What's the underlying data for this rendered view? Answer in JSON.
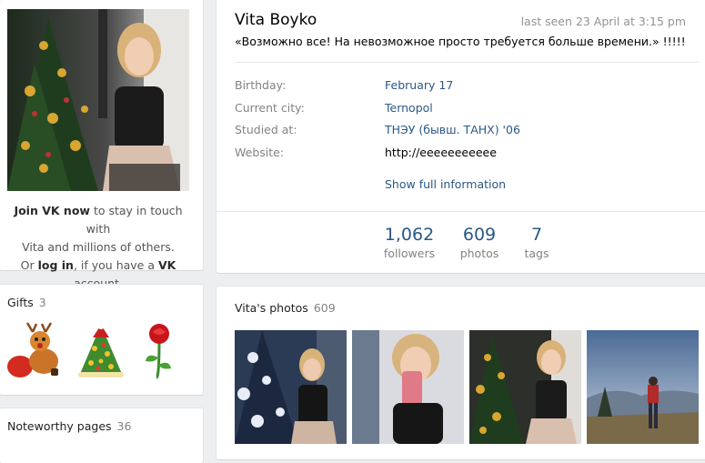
{
  "sidebar": {
    "join": {
      "join_link": "Join VK now",
      "line1_rest": " to stay in touch with",
      "line2": "Vita and millions of others.",
      "or": "Or ",
      "login_link": "log in",
      "line3_mid": ", if you have a ",
      "vk": "VK",
      "line3_end": " account."
    },
    "gifts": {
      "title": "Gifts",
      "count": "3",
      "items": [
        "reindeer-gift",
        "christmas-tree-gift",
        "rose-gift"
      ]
    },
    "noteworthy": {
      "title": "Noteworthy pages",
      "count": "36"
    }
  },
  "profile": {
    "name": "Vita Boyko",
    "last_seen": "last seen 23 April at 3:15 pm",
    "status": "«Возможно все! На невозможное просто требуется больше времени.» !!!!!",
    "info": [
      {
        "label": "Birthday:",
        "value": "February 17"
      },
      {
        "label": "Current city:",
        "value": "Ternopol"
      },
      {
        "label": "Studied at:",
        "value": "ТНЭУ (бывш. ТАНХ) '06"
      },
      {
        "label": "Website:",
        "value": "http://eeeeeeeeeee"
      }
    ],
    "show_full": "Show full information",
    "counters": [
      {
        "num": "1,062",
        "label": "followers"
      },
      {
        "num": "609",
        "label": "photos"
      },
      {
        "num": "7",
        "label": "tags"
      }
    ]
  },
  "photos": {
    "title": "Vita's photos",
    "count": "609"
  },
  "colors": {
    "link": "#2a5885",
    "muted": "#828282",
    "background": "#edeef0"
  }
}
